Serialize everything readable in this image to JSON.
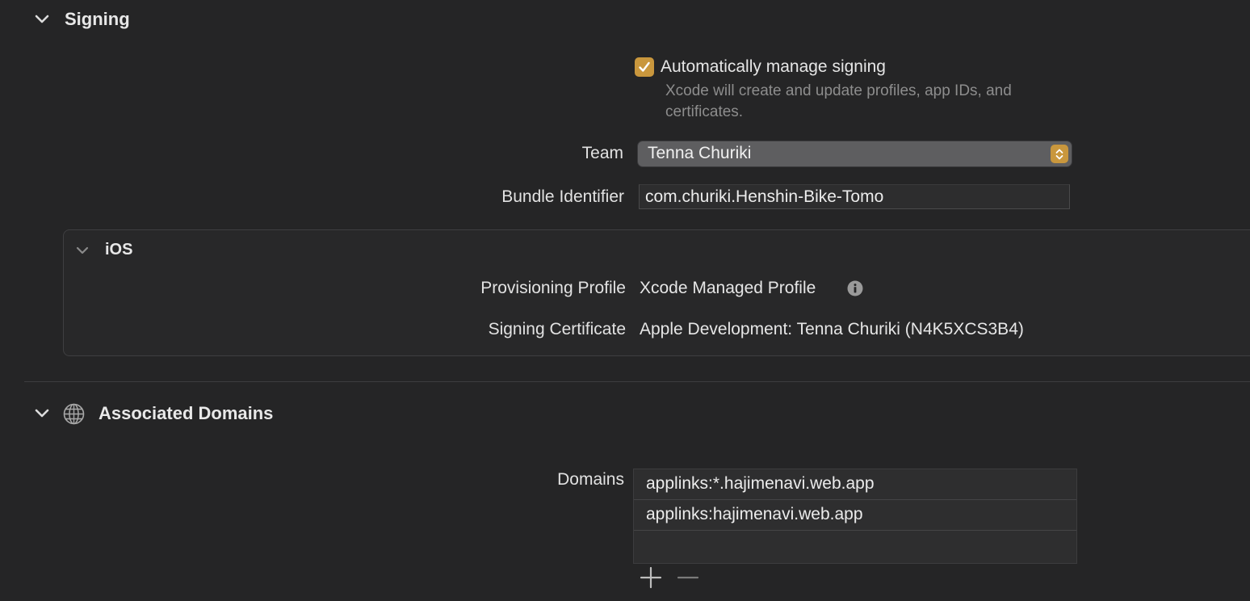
{
  "signing": {
    "title": "Signing",
    "auto_manage_label": "Automatically manage signing",
    "auto_manage_checked": true,
    "auto_manage_hint": "Xcode will create and update profiles, app IDs, and certificates.",
    "team_label": "Team",
    "team_value": "Tenna Churiki",
    "bundle_label": "Bundle Identifier",
    "bundle_value": "com.churiki.Henshin-Bike-Tomo",
    "ios": {
      "title": "iOS",
      "profile_label": "Provisioning Profile",
      "profile_value": "Xcode Managed Profile",
      "certificate_label": "Signing Certificate",
      "certificate_value": "Apple Development: Tenna Churiki (N4K5XCS3B4)"
    }
  },
  "associated_domains": {
    "title": "Associated Domains",
    "domains_label": "Domains",
    "domains": [
      "applinks:*.hajimenavi.web.app",
      "applinks:hajimenavi.web.app",
      ""
    ]
  },
  "colors": {
    "accent": "#c9973d",
    "background": "#252526"
  },
  "icons": {
    "section_chevron": "chevron-down-icon",
    "info": "info-icon",
    "globe": "globe-icon",
    "add": "plus-icon",
    "remove": "minus-icon",
    "popup_arrows": "updown-arrows-icon"
  }
}
